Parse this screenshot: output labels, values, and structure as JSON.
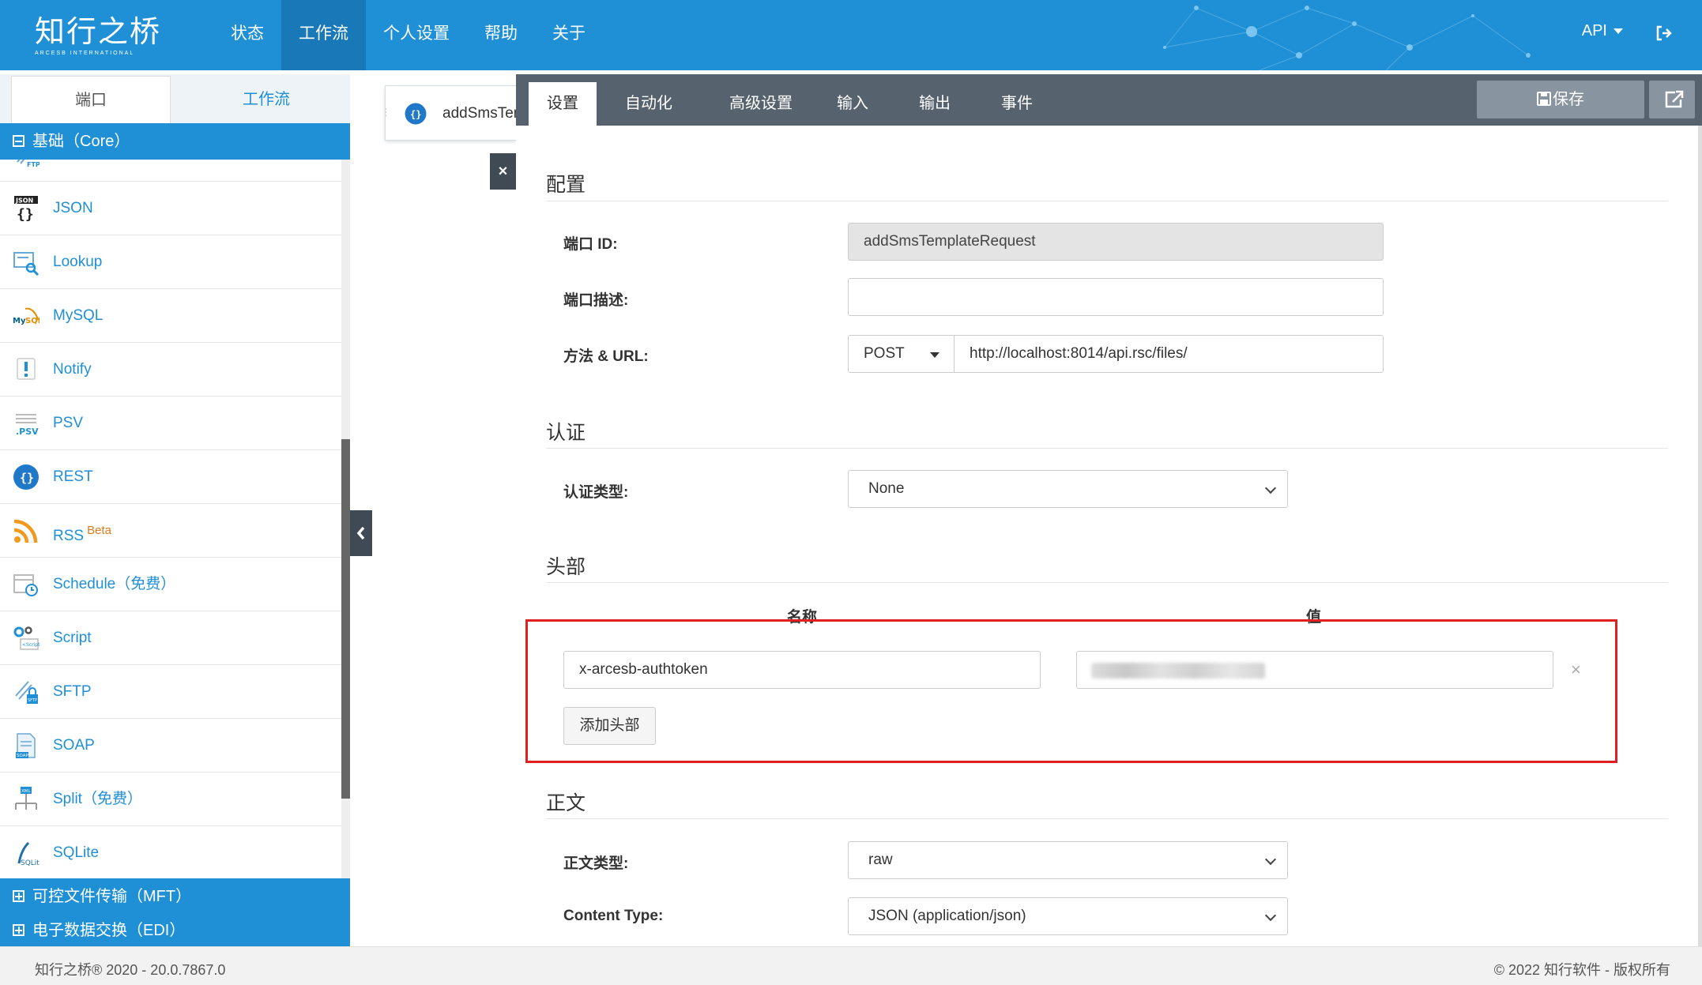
{
  "app": {
    "logo_cn": "知行之桥",
    "logo_en": "ARCESB INTERNATIONAL"
  },
  "nav": {
    "items": [
      "状态",
      "工作流",
      "个人设置",
      "帮助",
      "关于"
    ],
    "active": "工作流",
    "api_menu": "API"
  },
  "sidebar": {
    "tabs": [
      "端口",
      "工作流"
    ],
    "group_core": "基础（Core）",
    "group_mft": "可控文件传输（MFT）",
    "group_edi": "电子数据交换（EDI）",
    "connectors": [
      {
        "label": "FTP",
        "icon": "ftp-icon"
      },
      {
        "label": "JSON",
        "icon": "json-icon"
      },
      {
        "label": "Lookup",
        "icon": "lookup-icon"
      },
      {
        "label": "MySQL",
        "icon": "mysql-icon"
      },
      {
        "label": "Notify",
        "icon": "notify-icon"
      },
      {
        "label": "PSV",
        "icon": "psv-icon"
      },
      {
        "label": "REST",
        "icon": "rest-icon"
      },
      {
        "label": "RSS",
        "badge": "Beta",
        "icon": "rss-icon"
      },
      {
        "label": "Schedule（免费）",
        "icon": "schedule-icon"
      },
      {
        "label": "Script",
        "icon": "script-icon"
      },
      {
        "label": "SFTP",
        "icon": "sftp-icon"
      },
      {
        "label": "SOAP",
        "icon": "soap-icon"
      },
      {
        "label": "Split（免费）",
        "icon": "split-icon"
      },
      {
        "label": "SQLite",
        "icon": "sqlite-icon"
      }
    ]
  },
  "open_tab": {
    "label": "addSmsTemplateRequest"
  },
  "main": {
    "tabs": [
      "设置",
      "自动化",
      "高级设置",
      "输入",
      "输出",
      "事件"
    ],
    "active_tab": "设置",
    "save_label": "保存",
    "sections": {
      "config": "配置",
      "auth": "认证",
      "headers": "头部",
      "body": "正文"
    },
    "fields": {
      "port_id_label": "端口 ID:",
      "port_id_value": "addSmsTemplateRequest",
      "desc_label": "端口描述:",
      "desc_value": "",
      "method_url_label": "方法 & URL:",
      "method": "POST",
      "url": "http://localhost:8014/api.rsc/files/",
      "auth_type_label": "认证类型:",
      "auth_type": "None",
      "body_type_label": "正文类型:",
      "body_type": "raw",
      "content_type_label": "Content Type:",
      "content_type": "JSON (application/json)"
    },
    "headers": {
      "col_name": "名称",
      "col_value": "值",
      "rows": [
        {
          "name": "x-arcesb-authtoken"
        }
      ],
      "remove_glyph": "×",
      "add_label": "添加头部"
    }
  },
  "footer": {
    "left": "知行之桥® 2020 - 20.0.7867.0",
    "right": "© 2022 知行软件 - 版权所有"
  },
  "colors": {
    "brand": "#1f8fd6",
    "tabbar": "#56626d",
    "highlight": "#e02020"
  }
}
